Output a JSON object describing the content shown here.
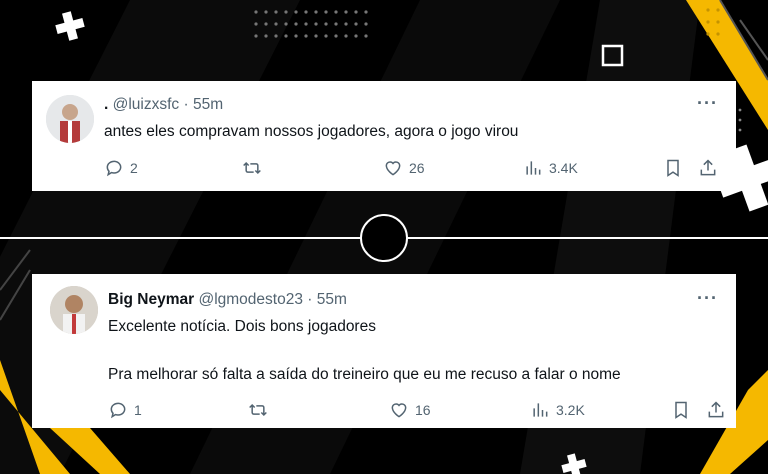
{
  "tweets": [
    {
      "name": ".",
      "handle": "@luizxsfc",
      "dot": "·",
      "time": "55m",
      "text": "antes eles compravam nossos jogadores, agora o jogo virou",
      "replies": "2",
      "retweets": "",
      "likes": "26",
      "views": "3.4K"
    },
    {
      "name": "Big Neymar",
      "handle": "@lgmodesto23",
      "dot": "·",
      "time": "55m",
      "text1": "Excelente notícia. Dois bons jogadores",
      "text2": "Pra melhorar só falta a saída do treineiro que eu me recuso a falar o nome",
      "replies": "1",
      "retweets": "",
      "likes": "16",
      "views": "3.2K"
    }
  ],
  "more_glyph": "···",
  "colors": {
    "accent": "#f5b800",
    "background": "#000000",
    "card": "#ffffff",
    "muted": "#536471"
  }
}
